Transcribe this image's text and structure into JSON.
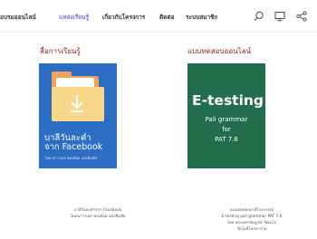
{
  "nav": {
    "items": [
      {
        "label": "อบรมออนไลน์"
      },
      {
        "label": "แหล่งเรียนรู้"
      },
      {
        "label": "เกี่ยวกับโครงการ"
      },
      {
        "label": "ติดต่อ"
      },
      {
        "label": "ระบบสมาชิก"
      }
    ],
    "active_index": 1,
    "active_color": "#8a6ce6",
    "icons": [
      "search-icon",
      "monitor-icon",
      "share-icon"
    ]
  },
  "sections": [
    {
      "title": "สื่อการเรียนรู้",
      "card": {
        "title_line1": "บาลีวันละคำ",
        "title_line2": "จาก Facebook",
        "subtitle": "โดย นาวาเอก ทองย้อย แสงสินชัย",
        "caption_line1": "บาลีวันละคำจาก Facebook",
        "caption_line2": "โดยนาวาเอก ทองย้อย แสงสินชัย"
      },
      "title_color": "#8b1e1e",
      "card_color": "#2d6ec5"
    },
    {
      "title": "แบบทดสอบออนไลน์",
      "card": {
        "title": "E-testing",
        "line1": "Pali grammar",
        "line2": "for",
        "line3": "PAT 7.6",
        "caption_line1": "แบบทดสอบบาลีไวยากรณ์",
        "caption_line2": "E-testing pali grammar PAT 7.6",
        "caption_line3": "โดย พระมหาสมบูรณ์ วัฒนโก",
        "caption_line4": "วัดโมลีโลกยาราม"
      },
      "title_color": "#8b1e1e",
      "card_color": "#226d4c"
    }
  ]
}
